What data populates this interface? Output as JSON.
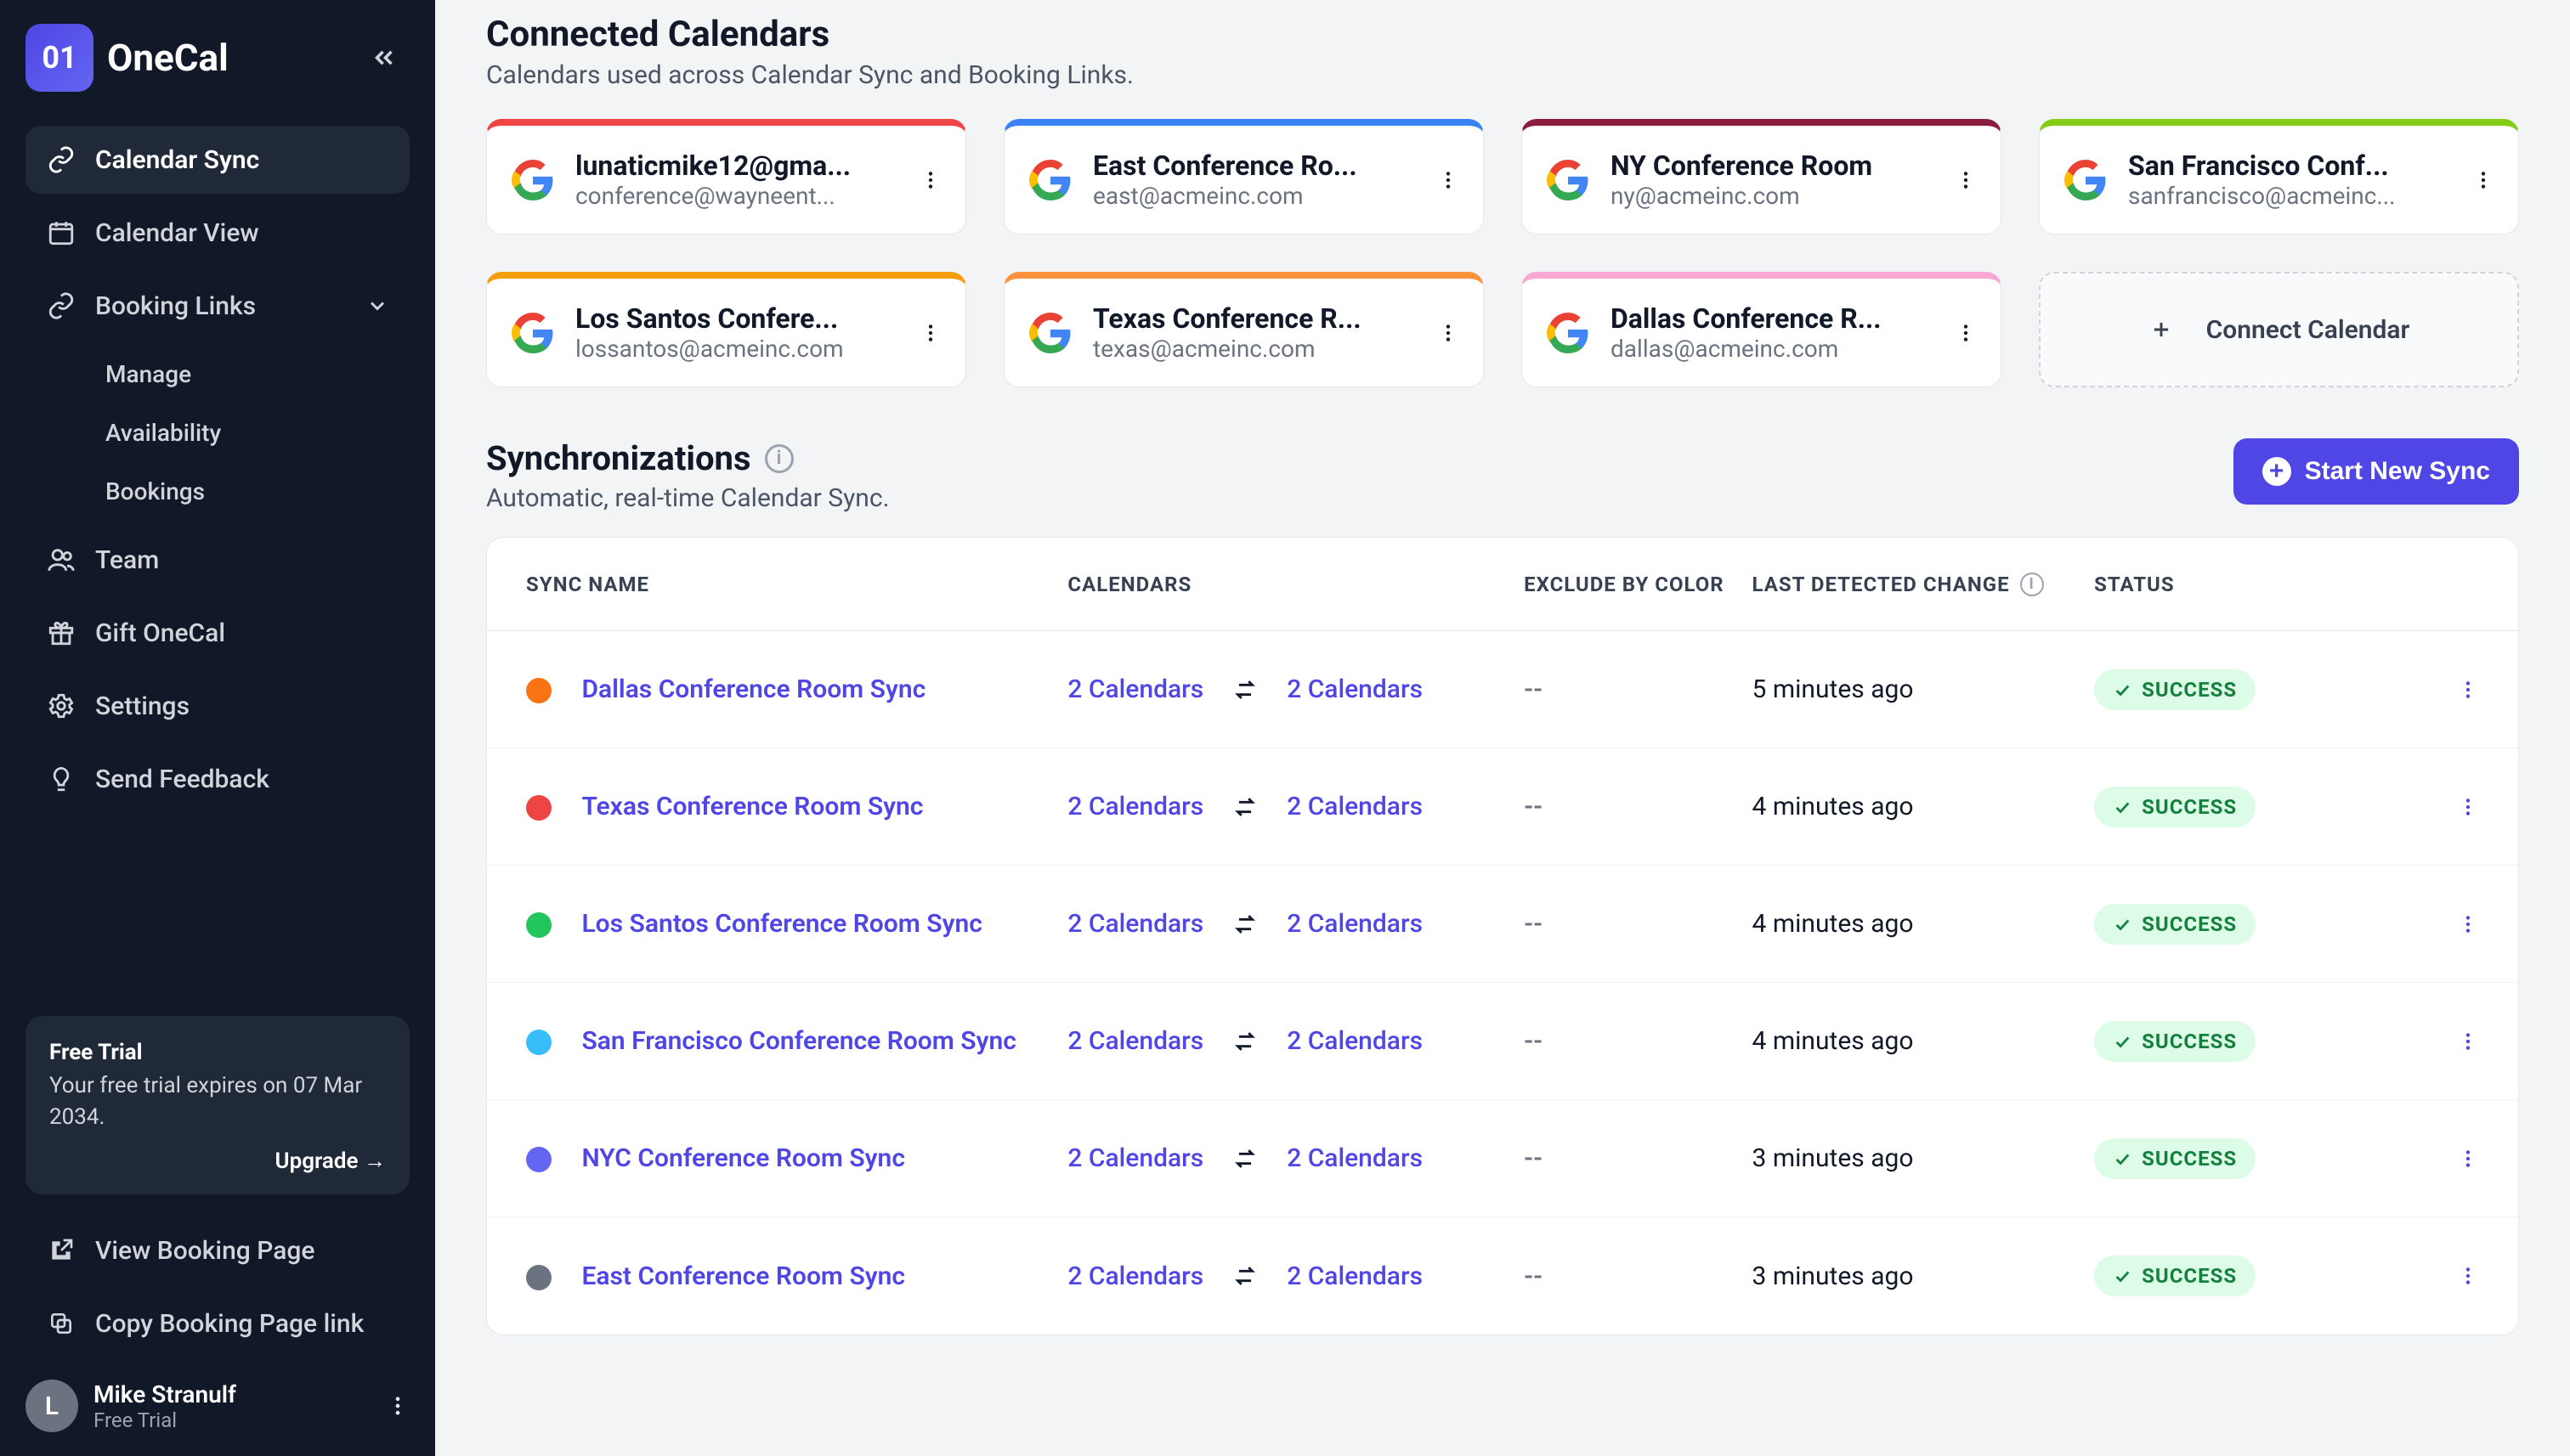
{
  "brand": {
    "mark": "01",
    "name": "OneCal"
  },
  "sidebar": {
    "items": [
      {
        "id": "calendar-sync",
        "label": "Calendar Sync",
        "icon": "link-icon",
        "active": true
      },
      {
        "id": "calendar-view",
        "label": "Calendar View",
        "icon": "calendar-icon"
      },
      {
        "id": "booking-links",
        "label": "Booking Links",
        "icon": "link-icon",
        "expandable": true,
        "expanded": true
      },
      {
        "id": "team",
        "label": "Team",
        "icon": "users-icon"
      },
      {
        "id": "gift",
        "label": "Gift OneCal",
        "icon": "gift-icon"
      },
      {
        "id": "settings",
        "label": "Settings",
        "icon": "gear-icon"
      },
      {
        "id": "feedback",
        "label": "Send Feedback",
        "icon": "bulb-icon"
      }
    ],
    "booking_sub": [
      {
        "id": "manage",
        "label": "Manage"
      },
      {
        "id": "availability",
        "label": "Availability"
      },
      {
        "id": "bookings",
        "label": "Bookings"
      }
    ],
    "trial": {
      "title": "Free Trial",
      "desc_prefix": "Your free trial expires on ",
      "desc_date": "07 Mar 2034",
      "desc_suffix": ".",
      "upgrade_label": "Upgrade →"
    },
    "footer": [
      {
        "id": "view-booking-page",
        "label": "View Booking Page",
        "icon": "external-icon"
      },
      {
        "id": "copy-booking-link",
        "label": "Copy Booking Page link",
        "icon": "copy-icon"
      }
    ],
    "user": {
      "initial": "L",
      "name": "Mike Stranulf",
      "plan": "Free Trial"
    }
  },
  "page": {
    "title": "Connected Calendars",
    "subtitle": "Calendars used across Calendar Sync and Booking Links."
  },
  "calendars": [
    {
      "color": "#ef4444",
      "name": "lunaticmike12@gma...",
      "email": "conference@wayneent..."
    },
    {
      "color": "#3b82f6",
      "name": "East Conference Ro...",
      "email": "east@acmeinc.com"
    },
    {
      "color": "#8b1e3f",
      "name": "NY Conference Room",
      "email": "ny@acmeinc.com"
    },
    {
      "color": "#84cc16",
      "name": "San Francisco Conf...",
      "email": "sanfrancisco@acmeinc..."
    },
    {
      "color": "#f59e0b",
      "name": "Los Santos Confere...",
      "email": "lossantos@acmeinc.com"
    },
    {
      "color": "#fb923c",
      "name": "Texas Conference R...",
      "email": "texas@acmeinc.com"
    },
    {
      "color": "#f9a8d4",
      "name": "Dallas Conference R...",
      "email": "dallas@acmeinc.com"
    }
  ],
  "connect_label": "Connect Calendar",
  "sync_section": {
    "title": "Synchronizations",
    "subtitle": "Automatic, real-time Calendar Sync.",
    "info_char": "i",
    "button": "Start New Sync"
  },
  "table": {
    "headers": {
      "sync_name": "SYNC NAME",
      "calendars": "CALENDARS",
      "exclude": "EXCLUDE BY COLOR",
      "last": "LAST DETECTED CHANGE",
      "status": "STATUS"
    },
    "info_char": "i",
    "calendars_label": "2 Calendars",
    "success_label": "SUCCESS",
    "rows": [
      {
        "dot": "#f97316",
        "name": "Dallas Conference Room Sync",
        "exclude": "--",
        "last": "5 minutes ago"
      },
      {
        "dot": "#ef4444",
        "name": "Texas Conference Room Sync",
        "exclude": "--",
        "last": "4 minutes ago"
      },
      {
        "dot": "#22c55e",
        "name": "Los Santos Conference Room Sync",
        "exclude": "--",
        "last": "4 minutes ago"
      },
      {
        "dot": "#38bdf8",
        "name": "San Francisco Conference Room Sync",
        "exclude": "--",
        "last": "4 minutes ago"
      },
      {
        "dot": "#6366f1",
        "name": "NYC Conference Room Sync",
        "exclude": "--",
        "last": "3 minutes ago"
      },
      {
        "dot": "#6b7280",
        "name": "East Conference Room Sync",
        "exclude": "--",
        "last": "3 minutes ago"
      }
    ]
  }
}
